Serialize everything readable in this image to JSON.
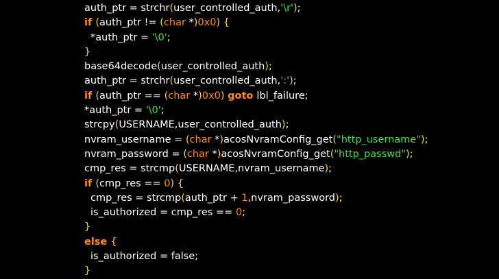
{
  "code_lines": [
    {
      "indent": 0,
      "tokens": [
        {
          "t": "pl",
          "v": "auth_ptr = strchr"
        },
        {
          "t": "br",
          "v": "("
        },
        {
          "t": "pl",
          "v": "user_controlled_auth,"
        },
        {
          "t": "st",
          "v": "'\\r'"
        },
        {
          "t": "br",
          "v": ")"
        },
        {
          "t": "pl",
          "v": ";"
        }
      ]
    },
    {
      "indent": 0,
      "tokens": [
        {
          "t": "kw",
          "v": "if "
        },
        {
          "t": "br",
          "v": "("
        },
        {
          "t": "pl",
          "v": "auth_ptr != "
        },
        {
          "t": "br",
          "v": "("
        },
        {
          "t": "ty",
          "v": "char "
        },
        {
          "t": "pl",
          "v": "*"
        },
        {
          "t": "br",
          "v": ")"
        },
        {
          "t": "nu",
          "v": "0x0"
        },
        {
          "t": "br",
          "v": ")"
        },
        {
          "t": "pl",
          "v": " "
        },
        {
          "t": "br",
          "v": "{"
        }
      ]
    },
    {
      "indent": 1,
      "tokens": [
        {
          "t": "pl",
          "v": "*auth_ptr = "
        },
        {
          "t": "st",
          "v": "'\\0'"
        },
        {
          "t": "pl",
          "v": ";"
        }
      ]
    },
    {
      "indent": 0,
      "tokens": [
        {
          "t": "br",
          "v": "}"
        }
      ]
    },
    {
      "indent": 0,
      "tokens": [
        {
          "t": "pl",
          "v": "base64decode"
        },
        {
          "t": "br",
          "v": "("
        },
        {
          "t": "pl",
          "v": "user_controlled_auth"
        },
        {
          "t": "br",
          "v": ")"
        },
        {
          "t": "pl",
          "v": ";"
        }
      ]
    },
    {
      "indent": 0,
      "tokens": [
        {
          "t": "pl",
          "v": "auth_ptr = strchr"
        },
        {
          "t": "br",
          "v": "("
        },
        {
          "t": "pl",
          "v": "user_controlled_auth,"
        },
        {
          "t": "st",
          "v": "':'"
        },
        {
          "t": "br",
          "v": ")"
        },
        {
          "t": "pl",
          "v": ";"
        }
      ]
    },
    {
      "indent": 0,
      "tokens": [
        {
          "t": "kw",
          "v": "if "
        },
        {
          "t": "br",
          "v": "("
        },
        {
          "t": "pl",
          "v": "auth_ptr == "
        },
        {
          "t": "br",
          "v": "("
        },
        {
          "t": "ty",
          "v": "char "
        },
        {
          "t": "pl",
          "v": "*"
        },
        {
          "t": "br",
          "v": ")"
        },
        {
          "t": "nu",
          "v": "0x0"
        },
        {
          "t": "br",
          "v": ")"
        },
        {
          "t": "pl",
          "v": " "
        },
        {
          "t": "kw",
          "v": "goto "
        },
        {
          "t": "pl",
          "v": "lbl_failure;"
        }
      ]
    },
    {
      "indent": 0,
      "tokens": [
        {
          "t": "pl",
          "v": "*auth_ptr = "
        },
        {
          "t": "st",
          "v": "'\\0'"
        },
        {
          "t": "pl",
          "v": ";"
        }
      ]
    },
    {
      "indent": 0,
      "tokens": [
        {
          "t": "pl",
          "v": "strcpy"
        },
        {
          "t": "br",
          "v": "("
        },
        {
          "t": "pl",
          "v": "USERNAME,user_controlled_auth"
        },
        {
          "t": "br",
          "v": ")"
        },
        {
          "t": "pl",
          "v": ";"
        }
      ]
    },
    {
      "indent": 0,
      "tokens": [
        {
          "t": "pl",
          "v": "nvram_username = "
        },
        {
          "t": "br",
          "v": "("
        },
        {
          "t": "ty",
          "v": "char "
        },
        {
          "t": "pl",
          "v": "*"
        },
        {
          "t": "br",
          "v": ")"
        },
        {
          "t": "pl",
          "v": "acosNvramConfig_get"
        },
        {
          "t": "br",
          "v": "("
        },
        {
          "t": "st",
          "v": "\"http_username\""
        },
        {
          "t": "br",
          "v": ")"
        },
        {
          "t": "pl",
          "v": ";"
        }
      ]
    },
    {
      "indent": 0,
      "tokens": [
        {
          "t": "pl",
          "v": "nvram_password = "
        },
        {
          "t": "br",
          "v": "("
        },
        {
          "t": "ty",
          "v": "char "
        },
        {
          "t": "pl",
          "v": "*"
        },
        {
          "t": "br",
          "v": ")"
        },
        {
          "t": "pl",
          "v": "acosNvramConfig_get"
        },
        {
          "t": "br",
          "v": "("
        },
        {
          "t": "st",
          "v": "\"http_passwd\""
        },
        {
          "t": "br",
          "v": ")"
        },
        {
          "t": "pl",
          "v": ";"
        }
      ]
    },
    {
      "indent": 0,
      "tokens": [
        {
          "t": "pl",
          "v": "cmp_res = strcmp"
        },
        {
          "t": "br",
          "v": "("
        },
        {
          "t": "pl",
          "v": "USERNAME,nvram_username"
        },
        {
          "t": "br",
          "v": ")"
        },
        {
          "t": "pl",
          "v": ";"
        }
      ]
    },
    {
      "indent": 0,
      "tokens": [
        {
          "t": "kw",
          "v": "if "
        },
        {
          "t": "br",
          "v": "("
        },
        {
          "t": "pl",
          "v": "cmp_res == "
        },
        {
          "t": "nu",
          "v": "0"
        },
        {
          "t": "br",
          "v": ")"
        },
        {
          "t": "pl",
          "v": " "
        },
        {
          "t": "br",
          "v": "{"
        }
      ]
    },
    {
      "indent": 1,
      "tokens": [
        {
          "t": "pl",
          "v": "cmp_res = strcmp"
        },
        {
          "t": "br",
          "v": "("
        },
        {
          "t": "pl",
          "v": "auth_ptr + "
        },
        {
          "t": "nu",
          "v": "1"
        },
        {
          "t": "pl",
          "v": ",nvram_password"
        },
        {
          "t": "br",
          "v": ")"
        },
        {
          "t": "pl",
          "v": ";"
        }
      ]
    },
    {
      "indent": 1,
      "tokens": [
        {
          "t": "pl",
          "v": "is_authorized = cmp_res == "
        },
        {
          "t": "nu",
          "v": "0"
        },
        {
          "t": "pl",
          "v": ";"
        }
      ]
    },
    {
      "indent": 0,
      "tokens": [
        {
          "t": "br",
          "v": "}"
        }
      ]
    },
    {
      "indent": 0,
      "tokens": [
        {
          "t": "kw",
          "v": "else "
        },
        {
          "t": "br",
          "v": "{"
        }
      ]
    },
    {
      "indent": 1,
      "tokens": [
        {
          "t": "pl",
          "v": "is_authorized = false;"
        }
      ]
    },
    {
      "indent": 0,
      "tokens": [
        {
          "t": "br",
          "v": "}"
        }
      ]
    }
  ],
  "colors": {
    "background": "#000000",
    "plain": "#ffffff",
    "keyword": "#ff8c1a",
    "bracket": "#ffd23c",
    "string": "#3ee04a",
    "number": "#ff8c1a"
  }
}
